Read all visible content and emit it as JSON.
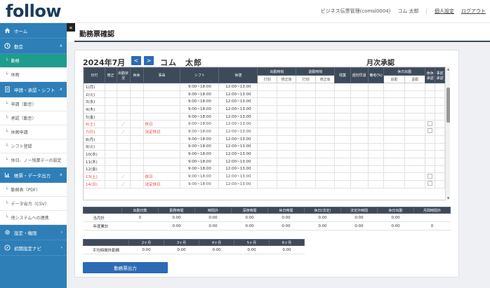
{
  "header": {
    "logo": "follow",
    "company": "ビジネス伝票管理(comsl0004)",
    "user": "コム 太郎",
    "separator": "|",
    "settings": "個人設定",
    "logout": "ログアウト"
  },
  "sidebar": {
    "home": "ホーム",
    "attendance": "勤怠",
    "attendance_sub": [
      "勤務",
      "休暇"
    ],
    "apply": "申請・承認・シフト",
    "apply_sub": [
      "申請（勤怠）",
      "承認（勤怠）",
      "休暇申請",
      "シフト登録",
      "休日、ノー残業デーの設定"
    ],
    "output": "帳票・データ出力",
    "output_sub": [
      "勤務表（PDF）",
      "データ出力（CSV）",
      "他システムへの連携"
    ],
    "settings": "設定・権限",
    "navi": "初期設定ナビ"
  },
  "page": {
    "title": "勤務票確認",
    "month": "2024年7月",
    "prev": "<",
    "next": ">",
    "employee": "コム　太郎",
    "approval": "月次承認",
    "collapse": "«"
  },
  "table": {
    "headers": {
      "date": "日付",
      "col2": "修正",
      "col3": "出勤状況",
      "col4": "休休",
      "reason": "事由",
      "shift": "シフト",
      "break": "休憩",
      "group_a": "出勤時刻",
      "group_b": "退勤時刻",
      "overtime": "残業",
      "late_early": "遅刻早退",
      "remarks": "備考(%)",
      "group_c": "休日出勤",
      "col_x": "休休承認",
      "col_y": "事前承認"
    },
    "subheaders": {
      "a1": "打刻",
      "a2": "修正後",
      "b1": "打刻",
      "b2": "修正後",
      "c1": "出勤",
      "c2": "退勤"
    },
    "rows": [
      {
        "date": "1(月)",
        "mark": "",
        "reason": "",
        "shift": "9:00~18:00",
        "break": "12:00~13:00",
        "hol": false,
        "chk": false
      },
      {
        "date": "2(火)",
        "mark": "",
        "reason": "",
        "shift": "9:00~18:00",
        "break": "12:00~13:00",
        "hol": false,
        "chk": false
      },
      {
        "date": "3(水)",
        "mark": "",
        "reason": "",
        "shift": "9:00~18:00",
        "break": "12:00~13:00",
        "hol": false,
        "chk": false
      },
      {
        "date": "4(木)",
        "mark": "",
        "reason": "",
        "shift": "9:00~18:00",
        "break": "12:00~13:00",
        "hol": false,
        "chk": false
      },
      {
        "date": "5(金)",
        "mark": "",
        "reason": "",
        "shift": "9:00~18:00",
        "break": "12:00~13:00",
        "hol": false,
        "chk": false
      },
      {
        "date": "6(土)",
        "mark": "／",
        "reason": "休日",
        "shift": "9:00~18:00",
        "break": "12:00~13:00",
        "hol": true,
        "chk": true
      },
      {
        "date": "7(日)",
        "mark": "／",
        "reason": "法定休日",
        "shift": "9:00~18:00",
        "break": "12:00~13:00",
        "hol": true,
        "chk": true
      },
      {
        "date": "8(月)",
        "mark": "",
        "reason": "",
        "shift": "9:00~18:00",
        "break": "12:00~13:00",
        "hol": false,
        "chk": false
      },
      {
        "date": "9(火)",
        "mark": "",
        "reason": "",
        "shift": "9:00~18:00",
        "break": "12:00~13:00",
        "hol": false,
        "chk": false
      },
      {
        "date": "10(水)",
        "mark": "",
        "reason": "",
        "shift": "9:00~18:00",
        "break": "12:00~13:00",
        "hol": false,
        "chk": false
      },
      {
        "date": "11(木)",
        "mark": "",
        "reason": "",
        "shift": "9:00~18:00",
        "break": "12:00~13:00",
        "hol": false,
        "chk": false
      },
      {
        "date": "12(金)",
        "mark": "",
        "reason": "",
        "shift": "9:00~18:00",
        "break": "12:00~13:00",
        "hol": false,
        "chk": false
      },
      {
        "date": "13(土)",
        "mark": "／",
        "reason": "休日",
        "shift": "9:00~18:00",
        "break": "12:00~13:00",
        "hol": true,
        "chk": true
      },
      {
        "date": "14(日)",
        "mark": "／",
        "reason": "法定休日",
        "shift": "9:00~18:00",
        "break": "12:00~13:00",
        "hol": true,
        "chk": true
      }
    ]
  },
  "summary": {
    "headers": [
      "",
      "出勤日数",
      "勤務時間",
      "時間外",
      "深夜時間",
      "休日時間",
      "休日(法定)",
      "法定外時間",
      "休日出勤",
      "月間時間外"
    ],
    "rows": [
      {
        "label": "当月計",
        "values": [
          "0",
          "0:00",
          "0:00",
          "0:00",
          "0:00",
          "0:00",
          "0:00",
          "0:00",
          ""
        ]
      },
      {
        "label": "年度累計",
        "values": [
          "",
          "0:00",
          "0:00",
          "0:00",
          "0:00",
          "0:00",
          "0:00",
          "0:00",
          "0"
        ]
      }
    ]
  },
  "overtime": {
    "headers": [
      "",
      "2ヶ月",
      "3ヶ月",
      "4ヶ月",
      "5ヶ月",
      "6ヶ月"
    ],
    "label": "平均時間外勤務",
    "values": [
      "0:00",
      "0:00",
      "0:00",
      "0:00",
      "0:00"
    ]
  },
  "output_button": "勤務票出力"
}
